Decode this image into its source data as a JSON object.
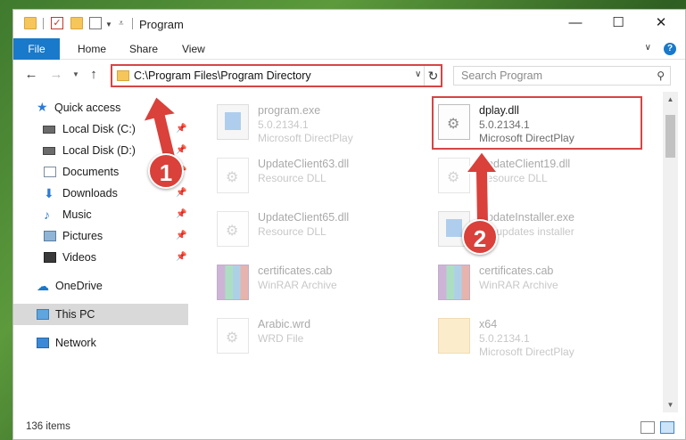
{
  "window": {
    "title": "Program",
    "controls": {
      "minimize": "—",
      "maximize": "☐",
      "close": "✕"
    }
  },
  "ribbon": {
    "tabs": [
      "File",
      "Home",
      "Share",
      "View"
    ]
  },
  "address_bar": {
    "path": "C:\\Program Files\\Program Directory",
    "search_placeholder": "Search Program"
  },
  "sidebar": {
    "items": [
      {
        "label": "Quick access",
        "icon": "star-icon",
        "pinned": false,
        "selected": false
      },
      {
        "label": "Local Disk (C:)",
        "icon": "disk-icon",
        "pinned": true,
        "selected": false
      },
      {
        "label": "Local Disk (D:)",
        "icon": "disk-icon",
        "pinned": true,
        "selected": false
      },
      {
        "label": "Documents",
        "icon": "documents-icon",
        "pinned": true,
        "selected": false
      },
      {
        "label": "Downloads",
        "icon": "download-icon",
        "pinned": true,
        "selected": false
      },
      {
        "label": "Music",
        "icon": "music-icon",
        "pinned": true,
        "selected": false
      },
      {
        "label": "Pictures",
        "icon": "pictures-icon",
        "pinned": true,
        "selected": false
      },
      {
        "label": "Videos",
        "icon": "videos-icon",
        "pinned": true,
        "selected": false
      },
      {
        "label": "OneDrive",
        "icon": "cloud-icon",
        "pinned": false,
        "selected": false
      },
      {
        "label": "This PC",
        "icon": "computer-icon",
        "pinned": false,
        "selected": true
      },
      {
        "label": "Network",
        "icon": "network-icon",
        "pinned": false,
        "selected": false
      }
    ]
  },
  "files": [
    {
      "name": "program.exe",
      "line1": "5.0.2134.1",
      "line2": "Microsoft DirectPlay",
      "icon": "exe-icon",
      "faded": true
    },
    {
      "name": "dplay.dll",
      "line1": "5.0.2134.1",
      "line2": "Microsoft DirectPlay",
      "icon": "dll-icon",
      "faded": false,
      "highlighted": true
    },
    {
      "name": "UpdateClient63.dll",
      "line1": "Resource DLL",
      "line2": "",
      "icon": "dll-icon",
      "faded": true
    },
    {
      "name": "UpdateClient19.dll",
      "line1": "Resource DLL",
      "line2": "",
      "icon": "dll-icon",
      "faded": true
    },
    {
      "name": "UpdateClient65.dll",
      "line1": "Resource DLL",
      "line2": "",
      "icon": "dll-icon",
      "faded": true
    },
    {
      "name": "UpdateInstaller.exe",
      "line1": "EV updates installer",
      "line2": "",
      "icon": "exe-icon",
      "faded": true
    },
    {
      "name": "certificates.cab",
      "line1": "WinRAR Archive",
      "line2": "",
      "icon": "rar-icon",
      "faded": true
    },
    {
      "name": "certificates.cab",
      "line1": "WinRAR Archive",
      "line2": "",
      "icon": "rar-icon",
      "faded": true
    },
    {
      "name": "Arabic.wrd",
      "line1": "WRD File",
      "line2": "",
      "icon": "document-icon",
      "faded": true
    },
    {
      "name": "x64",
      "line1": "5.0.2134.1",
      "line2": "Microsoft DirectPlay",
      "icon": "folder-icon",
      "faded": true
    }
  ],
  "status": {
    "item_count": "136 items"
  },
  "annotations": {
    "step1": "1",
    "step2": "2",
    "color": "#d64545"
  }
}
